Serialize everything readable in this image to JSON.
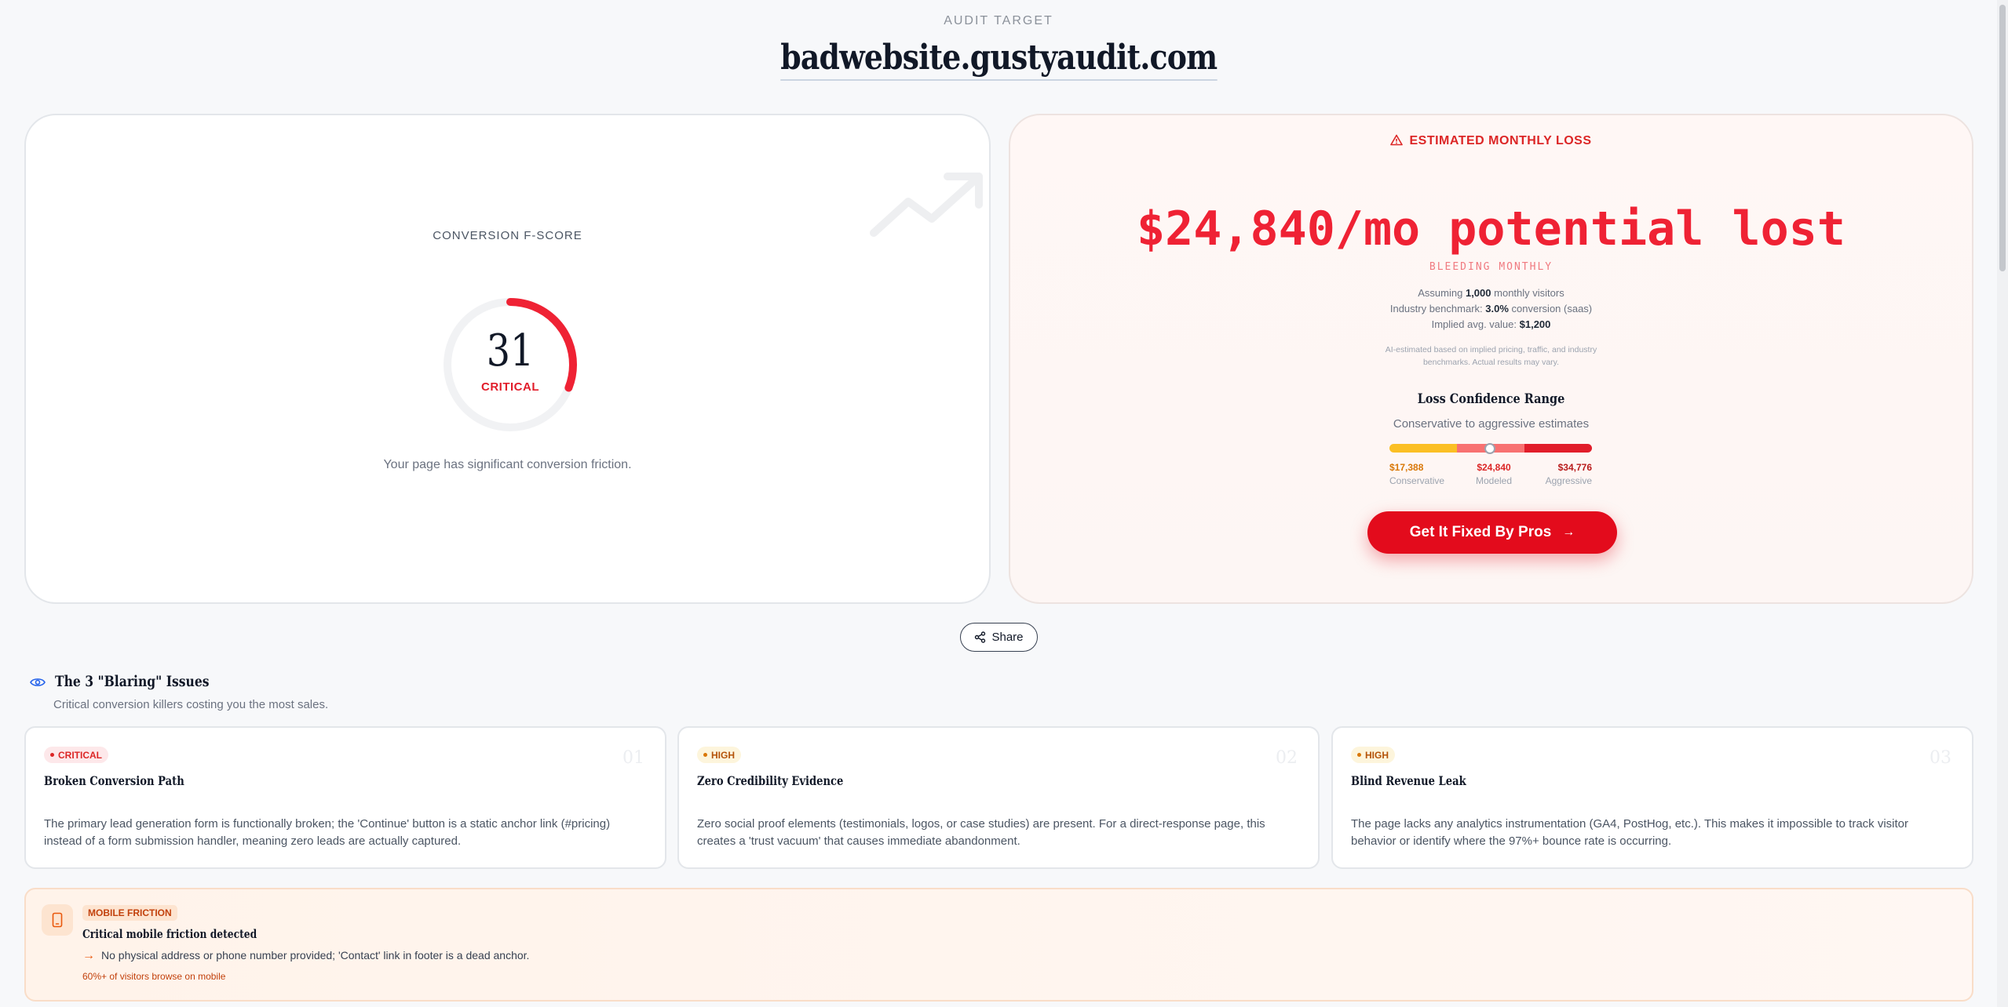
{
  "header": {
    "audit_label": "AUDIT TARGET",
    "domain": "badwebsite.gustyaudit.com"
  },
  "score": {
    "label": "CONVERSION F-SCORE",
    "value": "31",
    "score_fraction": 0.31,
    "status": "CRITICAL",
    "description": "Your page has significant conversion friction.",
    "gauge_color": "#ef2234",
    "track_color": "#f1f2f4"
  },
  "loss": {
    "header": "ESTIMATED MONTHLY LOSS",
    "amount": "$24,840/mo potential lost",
    "bleeding": "BLEEDING MONTHLY",
    "assume_prefix": "Assuming",
    "visitors": "1,000",
    "assume_suffix": "monthly visitors",
    "benchmark_prefix": "Industry benchmark:",
    "benchmark_value": "3.0%",
    "benchmark_suffix": "conversion (saas)",
    "avg_prefix": "Implied avg. value:",
    "avg_value": "$1,200",
    "disclaimer_line1": "AI-estimated based on implied pricing, traffic, and industry",
    "disclaimer_line2": "benchmarks. Actual results may vary.",
    "range_title": "Loss Confidence Range",
    "range_subtitle": "Conservative to aggressive estimates",
    "range": [
      {
        "value": "$17,388",
        "name": "Conservative"
      },
      {
        "value": "$24,840",
        "name": "Modeled"
      },
      {
        "value": "$34,776",
        "name": "Aggressive"
      }
    ],
    "cta": "Get It Fixed By Pros",
    "accent": "#e30b1c"
  },
  "share_label": "Share",
  "issues": {
    "title": "The 3 \"Blaring\" Issues",
    "subtitle": "Critical conversion killers costing you the most sales.",
    "items": [
      {
        "severity": "CRITICAL",
        "number": "01",
        "title": "Broken Conversion Path",
        "text": "The primary lead generation form is functionally broken; the 'Continue' button is a static anchor link (#pricing) instead of a form submission handler, meaning zero leads are actually captured."
      },
      {
        "severity": "HIGH",
        "number": "02",
        "title": "Zero Credibility Evidence",
        "text": "Zero social proof elements (testimonials, logos, or case studies) are present. For a direct-response page, this creates a 'trust vacuum' that causes immediate abandonment."
      },
      {
        "severity": "HIGH",
        "number": "03",
        "title": "Blind Revenue Leak",
        "text": "The page lacks any analytics instrumentation (GA4, PostHog, etc.). This makes it impossible to track visitor behavior or identify where the 97%+ bounce rate is occurring."
      }
    ]
  },
  "mobile": {
    "badge": "MOBILE FRICTION",
    "title": "Critical mobile friction detected",
    "detail": "No physical address or phone number provided; 'Contact' link in footer is a dead anchor.",
    "note": "60%+ of visitors browse on mobile"
  }
}
